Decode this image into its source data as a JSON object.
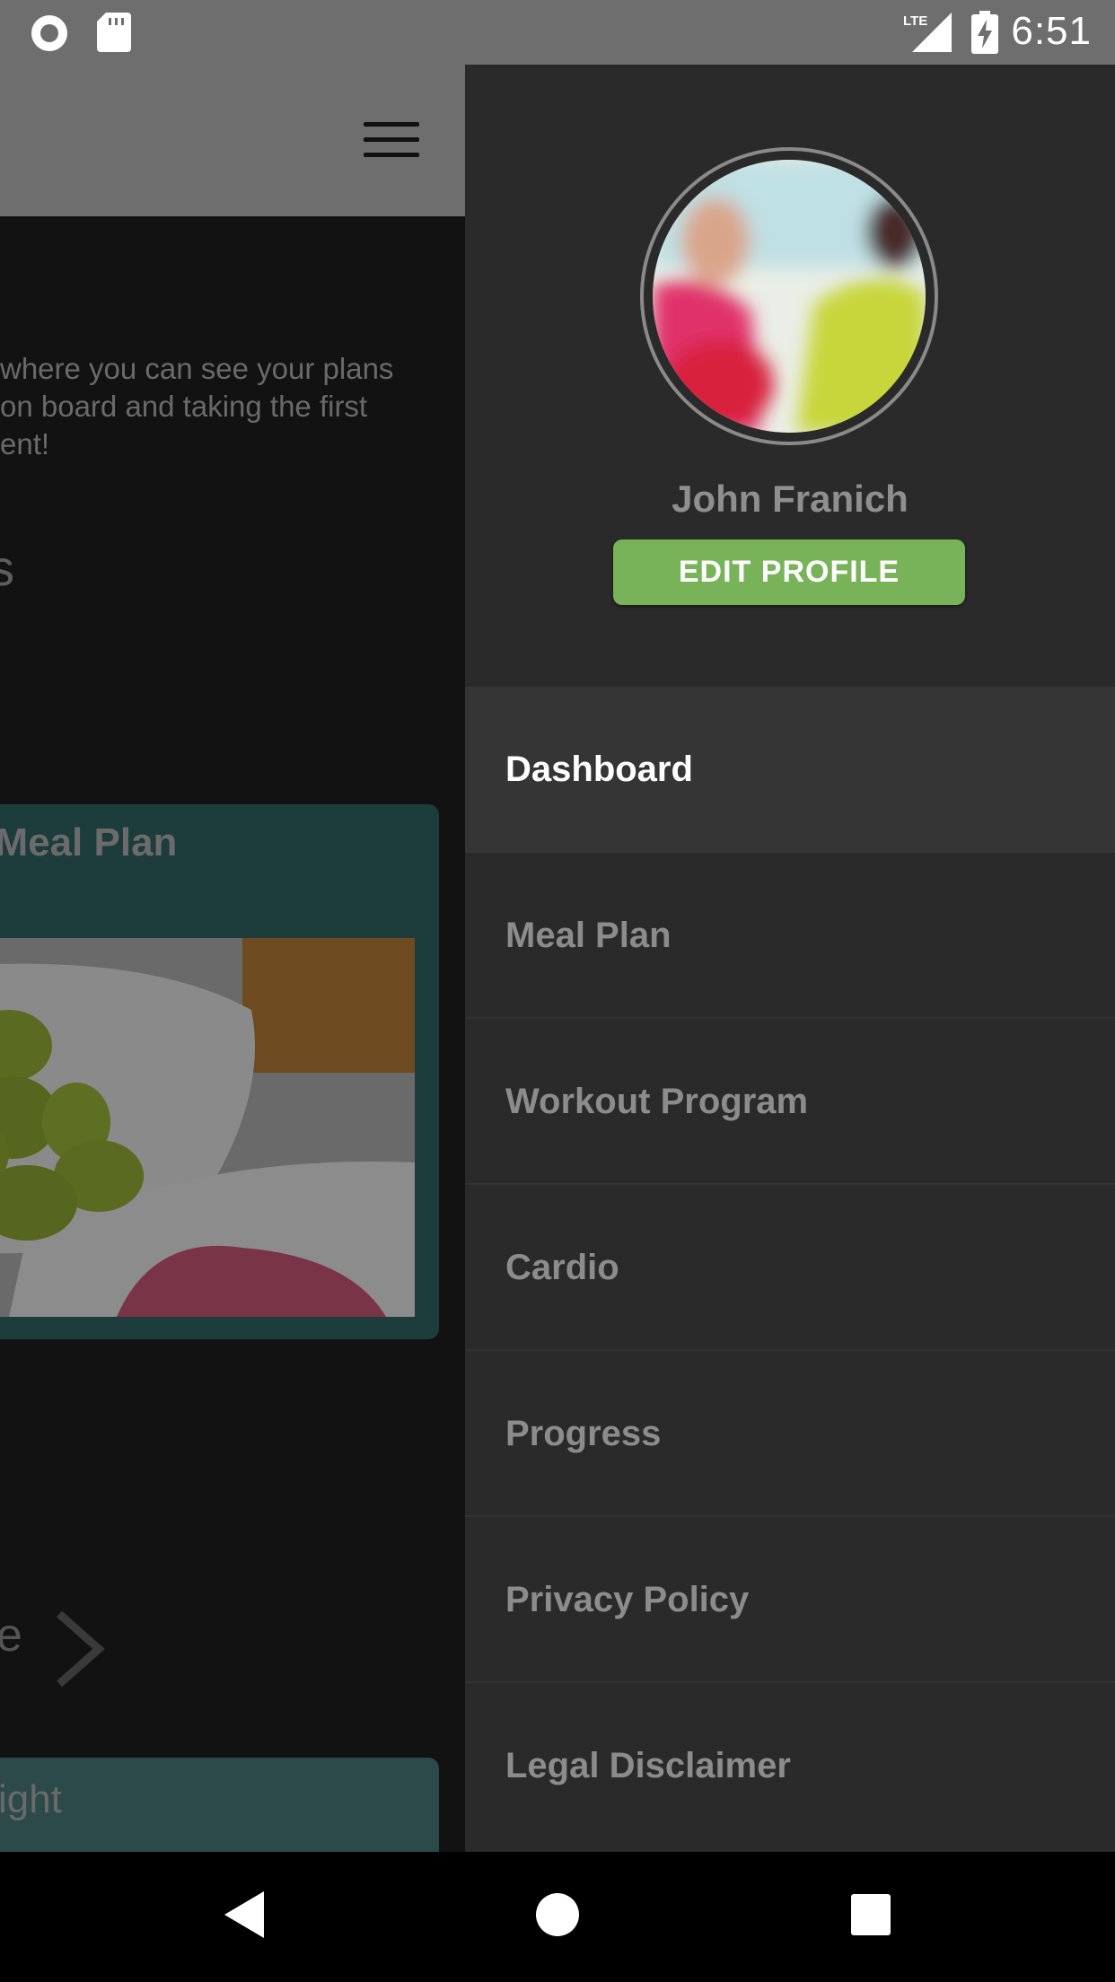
{
  "status_bar": {
    "time": "6:51",
    "network": "LTE",
    "icons": [
      "sync-icon",
      "sd-card-icon",
      "signal-icon",
      "battery-charging-icon"
    ]
  },
  "background_app": {
    "intro_lines": [
      "where you can see your plans",
      "on board and taking the first",
      "ent!"
    ],
    "section_fragment": "s",
    "meal_card_title": "l Meal Plan",
    "link_fragment": "e",
    "weight_card_text": "ight"
  },
  "drawer": {
    "user_name": "John Franich",
    "edit_profile_label": "EDIT PROFILE",
    "menu": [
      {
        "label": "Dashboard",
        "active": true
      },
      {
        "label": "Meal Plan",
        "active": false
      },
      {
        "label": "Workout Program",
        "active": false
      },
      {
        "label": "Cardio",
        "active": false
      },
      {
        "label": "Progress",
        "active": false
      },
      {
        "label": "Privacy Policy",
        "active": false
      },
      {
        "label": "Legal Disclaimer",
        "active": false
      }
    ]
  },
  "nav_bar": {
    "icons": [
      "back-icon",
      "home-icon",
      "recents-icon"
    ]
  },
  "colors": {
    "accent_green": "#78b35a",
    "drawer_bg": "#2a2a2a",
    "active_item_bg": "#353535",
    "card_teal": "#1d3c3c"
  }
}
